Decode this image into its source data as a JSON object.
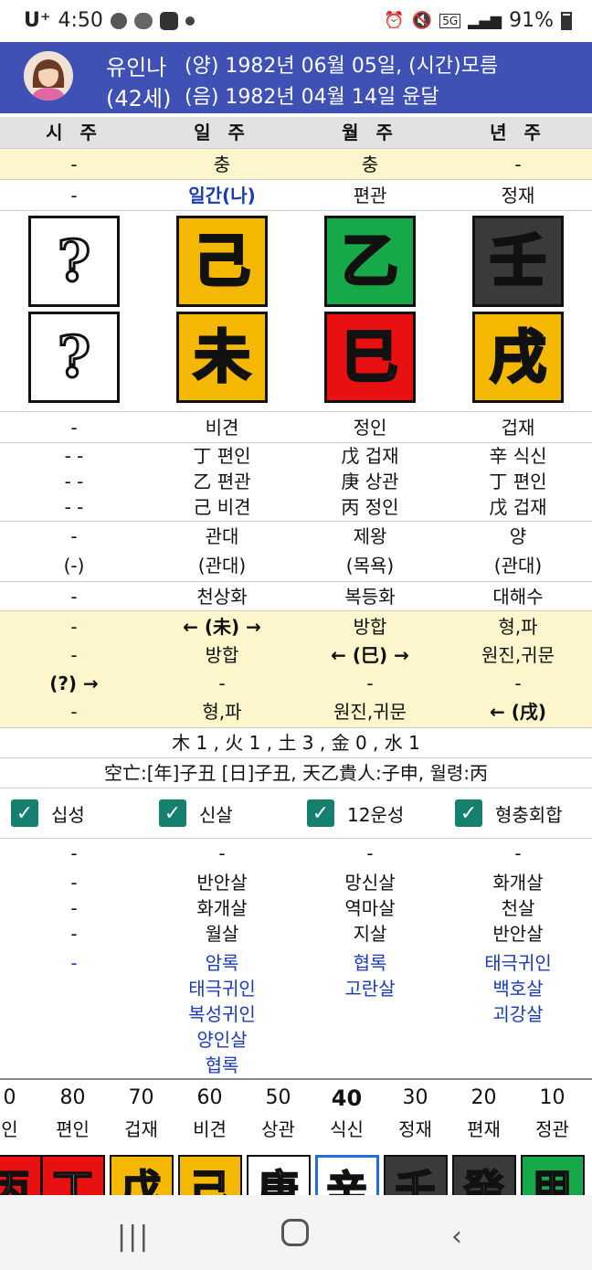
{
  "status_bar": {
    "carrier": "U⁺",
    "time": "4:50",
    "network": "5G",
    "battery": "91%"
  },
  "profile": {
    "name": "유인나",
    "age": "(42세)",
    "solar": "(양) 1982년 06월 05일, (시간)모름",
    "lunar": "(음) 1982년 04월 14일  윤달"
  },
  "columns": [
    "시 주",
    "일 주",
    "월 주",
    "년 주"
  ],
  "clash_row": [
    "-",
    "충",
    "충",
    "-"
  ],
  "sipsung_top": [
    "-",
    "일간(나)",
    "편관",
    "정재"
  ],
  "stems": [
    {
      "char": "?",
      "color": "#ffffff"
    },
    {
      "char": "己",
      "color": "#f5b800"
    },
    {
      "char": "乙",
      "color": "#17a84a"
    },
    {
      "char": "壬",
      "color": "#3a3a3a"
    }
  ],
  "branches": [
    {
      "char": "?",
      "color": "#ffffff"
    },
    {
      "char": "未",
      "color": "#f5b800"
    },
    {
      "char": "巳",
      "color": "#e81010"
    },
    {
      "char": "戌",
      "color": "#f5b800"
    }
  ],
  "sipsung_bottom": [
    "-",
    "비견",
    "정인",
    "겁재"
  ],
  "hidden_stems": [
    [
      "- -",
      "丁 편인",
      "戊 겁재",
      "辛 식신"
    ],
    [
      "- -",
      "乙 편관",
      "庚 상관",
      "丁 편인"
    ],
    [
      "- -",
      "己 비견",
      "丙 정인",
      "戊 겁재"
    ]
  ],
  "unsung": [
    "-",
    "관대",
    "제왕",
    "양"
  ],
  "unsung_sub": [
    "(-)",
    "(관대)",
    "(목욕)",
    "(관대)"
  ],
  "napeum": [
    "-",
    "천상화",
    "복등화",
    "대해수"
  ],
  "relations": [
    [
      "-",
      "← (未) →",
      "방합",
      "형,파"
    ],
    [
      "-",
      "방합",
      "← (巳) →",
      "원진,귀문"
    ],
    [
      "(?) →",
      "-",
      "-",
      "-"
    ],
    [
      "-",
      "형,파",
      "원진,귀문",
      "← (戌)"
    ]
  ],
  "elements": "木 1 , 火 1 , 土 3 , 金 0 , 水 1",
  "gongmang": "空亡:[年]子丑 [日]子丑, 天乙貴人:子申, 월령:丙",
  "checkboxes": [
    "십성",
    "신살",
    "12운성",
    "형충회합"
  ],
  "sinsal_black": [
    [
      "-",
      "-",
      "-",
      "-"
    ],
    [
      "-",
      "반안살",
      "망신살",
      "화개살"
    ],
    [
      "-",
      "화개살",
      "역마살",
      "천살"
    ],
    [
      "-",
      "월살",
      "지살",
      "반안살"
    ]
  ],
  "sinsal_blue": [
    [
      "-",
      "암록",
      "협록",
      "태극귀인"
    ],
    [
      "",
      "태극귀인",
      "고란살",
      "백호살"
    ],
    [
      "",
      "복성귀인",
      "",
      "괴강살"
    ],
    [
      "",
      "양인살",
      "",
      ""
    ],
    [
      "",
      "협록",
      "",
      ""
    ]
  ],
  "daewoon": [
    {
      "age": "0",
      "sip": "인",
      "char": "丙",
      "color": "#e81010"
    },
    {
      "age": "80",
      "sip": "편인",
      "char": "丁",
      "color": "#e81010"
    },
    {
      "age": "70",
      "sip": "겁재",
      "char": "戊",
      "color": "#f5b800"
    },
    {
      "age": "60",
      "sip": "비견",
      "char": "己",
      "color": "#f5b800"
    },
    {
      "age": "50",
      "sip": "상관",
      "char": "庚",
      "color": "#ffffff"
    },
    {
      "age": "40",
      "sip": "식신",
      "char": "辛",
      "color": "#ffffff",
      "current": true
    },
    {
      "age": "30",
      "sip": "정재",
      "char": "壬",
      "color": "#3a3a3a"
    },
    {
      "age": "20",
      "sip": "편재",
      "char": "癸",
      "color": "#3a3a3a"
    },
    {
      "age": "10",
      "sip": "정관",
      "char": "甲",
      "color": "#17a84a"
    }
  ]
}
